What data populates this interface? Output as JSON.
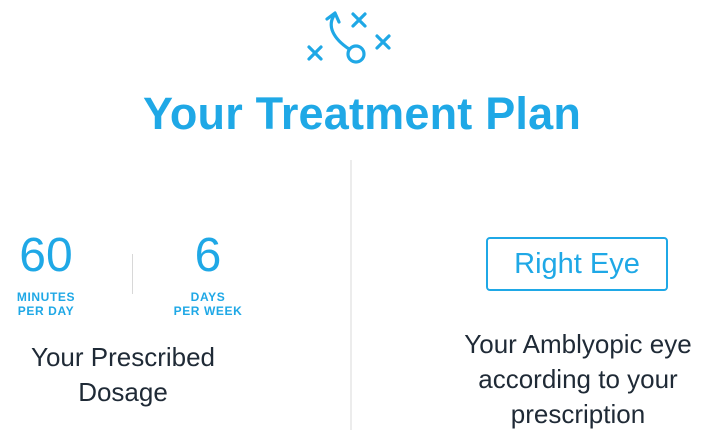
{
  "header": {
    "icon": "playbook-icon",
    "title": "Your Treatment Plan"
  },
  "dosage": {
    "minutes": {
      "value": "60",
      "unit_line1": "MINUTES",
      "unit_line2": "PER DAY"
    },
    "days": {
      "value": "6",
      "unit_line1": "DAYS",
      "unit_line2": "PER WEEK"
    },
    "label_line1": "Your Prescribed",
    "label_line2": "Dosage"
  },
  "eye": {
    "badge": "Right Eye",
    "label_line1": "Your Amblyopic eye",
    "label_line2": "according to your",
    "label_line3": "prescription"
  },
  "colors": {
    "accent": "#1fa8e6",
    "text": "#1f2a36",
    "divider": "#ececec"
  }
}
